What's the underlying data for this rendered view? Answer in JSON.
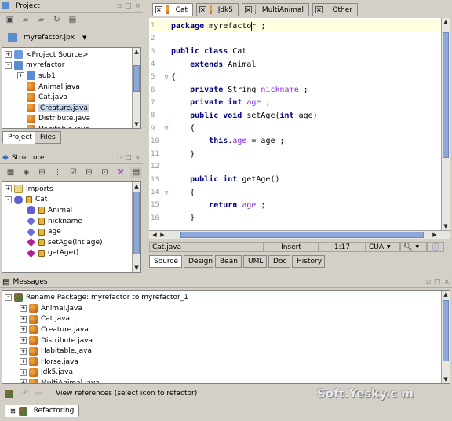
{
  "project": {
    "title": "Project",
    "file_combo": "myrefactor.jpx",
    "tree": [
      {
        "label": "<Project Source>",
        "icon": "src",
        "expander": "+",
        "indent": 0
      },
      {
        "label": "myrefactor",
        "icon": "pkg",
        "expander": "-",
        "indent": 0
      },
      {
        "label": "sub1",
        "icon": "pkg",
        "expander": "+",
        "indent": 1
      },
      {
        "label": "Animal.java",
        "icon": "java",
        "expander": "",
        "indent": 1
      },
      {
        "label": "Cat.java",
        "icon": "java",
        "expander": "",
        "indent": 1
      },
      {
        "label": "Creature.java",
        "icon": "java",
        "expander": "",
        "indent": 1,
        "selected": true
      },
      {
        "label": "Distribute.java",
        "icon": "java",
        "expander": "",
        "indent": 1
      },
      {
        "label": "Habitable.java",
        "icon": "java",
        "expander": "",
        "indent": 1
      }
    ],
    "tabs": [
      "Project",
      "Files"
    ]
  },
  "structure": {
    "title": "Structure",
    "tree": [
      {
        "label": "Imports",
        "icon": "folder",
        "expander": "+",
        "indent": 0
      },
      {
        "label": "Cat",
        "icon": "cls",
        "expander": "-",
        "indent": 0
      },
      {
        "label": "Animal",
        "icon": "parent",
        "expander": "",
        "indent": 1
      },
      {
        "label": "nickname",
        "icon": "field",
        "expander": "",
        "indent": 1
      },
      {
        "label": "age",
        "icon": "field",
        "expander": "",
        "indent": 1
      },
      {
        "label": "setAge(int age)",
        "icon": "method",
        "expander": "",
        "indent": 1
      },
      {
        "label": "getAge()",
        "icon": "method",
        "expander": "",
        "indent": 1
      }
    ]
  },
  "editor": {
    "tabs": [
      "Cat",
      "Jdk5",
      "MultiAnimal",
      "Other"
    ],
    "lines": [
      {
        "n": "1",
        "fold": "",
        "parts": [
          [
            "kw",
            "package"
          ],
          [
            "t",
            " myrefactor ;"
          ]
        ]
      },
      {
        "n": "2",
        "fold": "",
        "parts": []
      },
      {
        "n": "3",
        "fold": "",
        "parts": [
          [
            "kw",
            "public class"
          ],
          [
            "t",
            " Cat"
          ]
        ]
      },
      {
        "n": "4",
        "fold": "",
        "parts": [
          [
            "t",
            "    "
          ],
          [
            "kw",
            "extends"
          ],
          [
            "t",
            " Animal"
          ]
        ]
      },
      {
        "n": "5",
        "fold": "▽",
        "parts": [
          [
            "t",
            "{"
          ]
        ]
      },
      {
        "n": "6",
        "fold": "",
        "parts": [
          [
            "t",
            "    "
          ],
          [
            "kw",
            "private"
          ],
          [
            "t",
            " String "
          ],
          [
            "fld",
            "nickname"
          ],
          [
            "t",
            " ;"
          ]
        ]
      },
      {
        "n": "7",
        "fold": "",
        "parts": [
          [
            "t",
            "    "
          ],
          [
            "kw",
            "private int"
          ],
          [
            "t",
            " "
          ],
          [
            "fld",
            "age"
          ],
          [
            "t",
            " ;"
          ]
        ]
      },
      {
        "n": "8",
        "fold": "",
        "parts": [
          [
            "t",
            "    "
          ],
          [
            "kw",
            "public void"
          ],
          [
            "t",
            " setAge("
          ],
          [
            "kw",
            "int"
          ],
          [
            "t",
            " age)"
          ]
        ]
      },
      {
        "n": "9",
        "fold": "▽",
        "parts": [
          [
            "t",
            "    {"
          ]
        ]
      },
      {
        "n": "10",
        "fold": "",
        "parts": [
          [
            "t",
            "        "
          ],
          [
            "kw",
            "this"
          ],
          [
            "t",
            "."
          ],
          [
            "fld",
            "age"
          ],
          [
            "t",
            " = age ;"
          ]
        ]
      },
      {
        "n": "11",
        "fold": "",
        "parts": [
          [
            "t",
            "    }"
          ]
        ]
      },
      {
        "n": "12",
        "fold": "",
        "parts": []
      },
      {
        "n": "13",
        "fold": "",
        "parts": [
          [
            "t",
            "    "
          ],
          [
            "kw",
            "public int"
          ],
          [
            "t",
            " getAge()"
          ]
        ]
      },
      {
        "n": "14",
        "fold": "▽",
        "parts": [
          [
            "t",
            "    {"
          ]
        ]
      },
      {
        "n": "15",
        "fold": "",
        "parts": [
          [
            "t",
            "        "
          ],
          [
            "kw",
            "return"
          ],
          [
            "t",
            " "
          ],
          [
            "fld",
            "age"
          ],
          [
            "t",
            " ;"
          ]
        ]
      },
      {
        "n": "16",
        "fold": "",
        "parts": [
          [
            "t",
            "    }"
          ]
        ]
      }
    ],
    "status": {
      "file": "Cat.java",
      "mode": "Insert",
      "position": "1:17",
      "keymap": "CUA"
    },
    "bottom_tabs": [
      "Source",
      "Design",
      "Bean",
      "UML",
      "Doc",
      "History"
    ]
  },
  "messages": {
    "title": "Messages",
    "root": "Rename Package: myrefactor to myrefactor_1",
    "items": [
      "Animal.java",
      "Cat.java",
      "Creature.java",
      "Distribute.java",
      "Habitable.java",
      "Horse.java",
      "Jdk5.java",
      "MultiAnimal.java"
    ],
    "footer_text": "View references (select icon to refactor)",
    "tab": "Refactoring"
  },
  "watermark": "Soft.Yesky.c m",
  "colors": {
    "keyword": "#000080",
    "field": "#8a2be2",
    "accent": "#8da8d8"
  }
}
